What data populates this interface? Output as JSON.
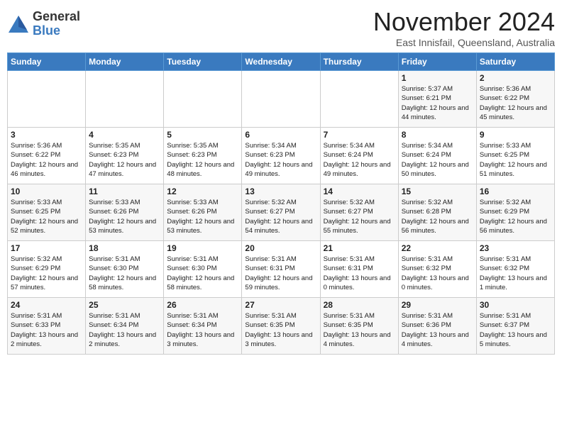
{
  "logo": {
    "general": "General",
    "blue": "Blue"
  },
  "title": "November 2024",
  "subtitle": "East Innisfail, Queensland, Australia",
  "days_of_week": [
    "Sunday",
    "Monday",
    "Tuesday",
    "Wednesday",
    "Thursday",
    "Friday",
    "Saturday"
  ],
  "weeks": [
    [
      {
        "day": "",
        "info": ""
      },
      {
        "day": "",
        "info": ""
      },
      {
        "day": "",
        "info": ""
      },
      {
        "day": "",
        "info": ""
      },
      {
        "day": "",
        "info": ""
      },
      {
        "day": "1",
        "info": "Sunrise: 5:37 AM\nSunset: 6:21 PM\nDaylight: 12 hours and 44 minutes."
      },
      {
        "day": "2",
        "info": "Sunrise: 5:36 AM\nSunset: 6:22 PM\nDaylight: 12 hours and 45 minutes."
      }
    ],
    [
      {
        "day": "3",
        "info": "Sunrise: 5:36 AM\nSunset: 6:22 PM\nDaylight: 12 hours and 46 minutes."
      },
      {
        "day": "4",
        "info": "Sunrise: 5:35 AM\nSunset: 6:23 PM\nDaylight: 12 hours and 47 minutes."
      },
      {
        "day": "5",
        "info": "Sunrise: 5:35 AM\nSunset: 6:23 PM\nDaylight: 12 hours and 48 minutes."
      },
      {
        "day": "6",
        "info": "Sunrise: 5:34 AM\nSunset: 6:23 PM\nDaylight: 12 hours and 49 minutes."
      },
      {
        "day": "7",
        "info": "Sunrise: 5:34 AM\nSunset: 6:24 PM\nDaylight: 12 hours and 49 minutes."
      },
      {
        "day": "8",
        "info": "Sunrise: 5:34 AM\nSunset: 6:24 PM\nDaylight: 12 hours and 50 minutes."
      },
      {
        "day": "9",
        "info": "Sunrise: 5:33 AM\nSunset: 6:25 PM\nDaylight: 12 hours and 51 minutes."
      }
    ],
    [
      {
        "day": "10",
        "info": "Sunrise: 5:33 AM\nSunset: 6:25 PM\nDaylight: 12 hours and 52 minutes."
      },
      {
        "day": "11",
        "info": "Sunrise: 5:33 AM\nSunset: 6:26 PM\nDaylight: 12 hours and 53 minutes."
      },
      {
        "day": "12",
        "info": "Sunrise: 5:33 AM\nSunset: 6:26 PM\nDaylight: 12 hours and 53 minutes."
      },
      {
        "day": "13",
        "info": "Sunrise: 5:32 AM\nSunset: 6:27 PM\nDaylight: 12 hours and 54 minutes."
      },
      {
        "day": "14",
        "info": "Sunrise: 5:32 AM\nSunset: 6:27 PM\nDaylight: 12 hours and 55 minutes."
      },
      {
        "day": "15",
        "info": "Sunrise: 5:32 AM\nSunset: 6:28 PM\nDaylight: 12 hours and 56 minutes."
      },
      {
        "day": "16",
        "info": "Sunrise: 5:32 AM\nSunset: 6:29 PM\nDaylight: 12 hours and 56 minutes."
      }
    ],
    [
      {
        "day": "17",
        "info": "Sunrise: 5:32 AM\nSunset: 6:29 PM\nDaylight: 12 hours and 57 minutes."
      },
      {
        "day": "18",
        "info": "Sunrise: 5:31 AM\nSunset: 6:30 PM\nDaylight: 12 hours and 58 minutes."
      },
      {
        "day": "19",
        "info": "Sunrise: 5:31 AM\nSunset: 6:30 PM\nDaylight: 12 hours and 58 minutes."
      },
      {
        "day": "20",
        "info": "Sunrise: 5:31 AM\nSunset: 6:31 PM\nDaylight: 12 hours and 59 minutes."
      },
      {
        "day": "21",
        "info": "Sunrise: 5:31 AM\nSunset: 6:31 PM\nDaylight: 13 hours and 0 minutes."
      },
      {
        "day": "22",
        "info": "Sunrise: 5:31 AM\nSunset: 6:32 PM\nDaylight: 13 hours and 0 minutes."
      },
      {
        "day": "23",
        "info": "Sunrise: 5:31 AM\nSunset: 6:32 PM\nDaylight: 13 hours and 1 minute."
      }
    ],
    [
      {
        "day": "24",
        "info": "Sunrise: 5:31 AM\nSunset: 6:33 PM\nDaylight: 13 hours and 2 minutes."
      },
      {
        "day": "25",
        "info": "Sunrise: 5:31 AM\nSunset: 6:34 PM\nDaylight: 13 hours and 2 minutes."
      },
      {
        "day": "26",
        "info": "Sunrise: 5:31 AM\nSunset: 6:34 PM\nDaylight: 13 hours and 3 minutes."
      },
      {
        "day": "27",
        "info": "Sunrise: 5:31 AM\nSunset: 6:35 PM\nDaylight: 13 hours and 3 minutes."
      },
      {
        "day": "28",
        "info": "Sunrise: 5:31 AM\nSunset: 6:35 PM\nDaylight: 13 hours and 4 minutes."
      },
      {
        "day": "29",
        "info": "Sunrise: 5:31 AM\nSunset: 6:36 PM\nDaylight: 13 hours and 4 minutes."
      },
      {
        "day": "30",
        "info": "Sunrise: 5:31 AM\nSunset: 6:37 PM\nDaylight: 13 hours and 5 minutes."
      }
    ]
  ]
}
